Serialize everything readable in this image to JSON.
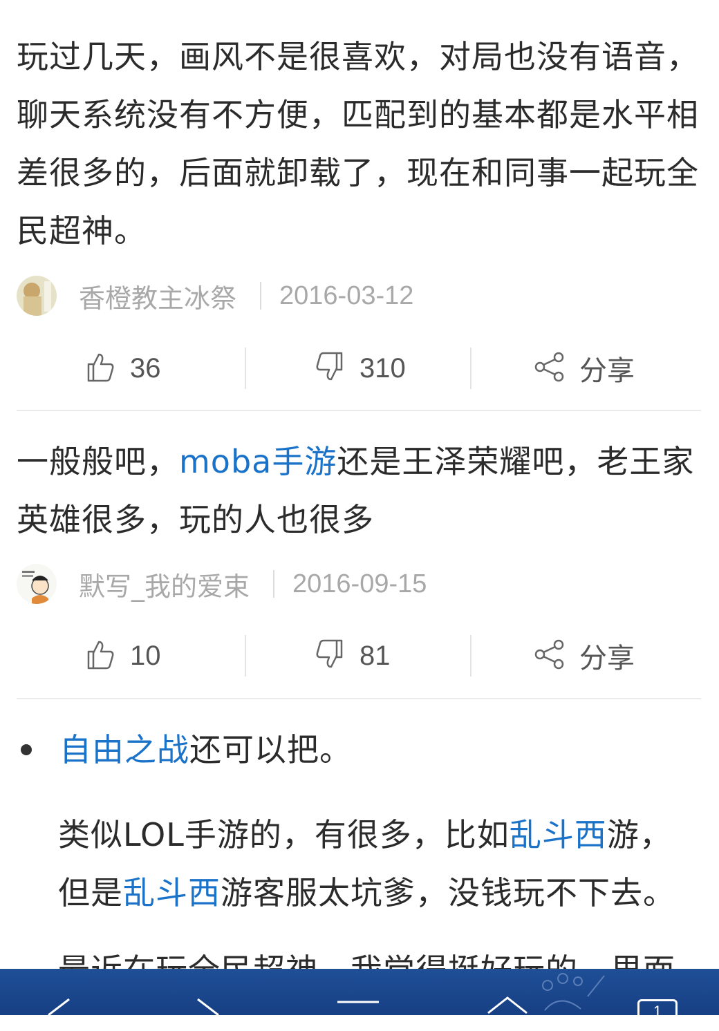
{
  "posts": [
    {
      "text": "玩过几天，画风不是很喜欢，对局也没有语音，聊天系统没有不方便，匹配到的基本都是水平相差很多的，后面就卸载了，现在和同事一起玩全民超神。",
      "author": "香橙教主冰祭",
      "date": "2016-03-12",
      "likes": "36",
      "dislikes": "310",
      "share_label": "分享"
    },
    {
      "text_before": "一般般吧，",
      "link": "moba手游",
      "text_after": "还是王泽荣耀吧，老王家英雄很多，玩的人也很多",
      "author": "默写_我的爱束",
      "date": "2016-09-15",
      "likes": "10",
      "dislikes": "81",
      "share_label": "分享"
    }
  ],
  "answer": {
    "bullet_link": "自由之战",
    "bullet_text": "还可以把。",
    "p1_before": "类似LOL手游的，有很多，比如",
    "p1_link": "乱斗西",
    "p1_after": "游，",
    "p2_before": "但是",
    "p2_link": "乱斗西",
    "p2_after": "游客服太坑爹，没钱玩不下去。",
    "p3_partial": "最近在玩全民超神，我觉得挺好玩的，里面"
  },
  "nav": {
    "items": [
      "back-icon",
      "forward-icon",
      "menu-icon",
      "home-icon",
      "tabs-icon"
    ],
    "tab_count": "1"
  },
  "colors": {
    "link": "#1a73c9",
    "navbar": "#1f4f97"
  }
}
